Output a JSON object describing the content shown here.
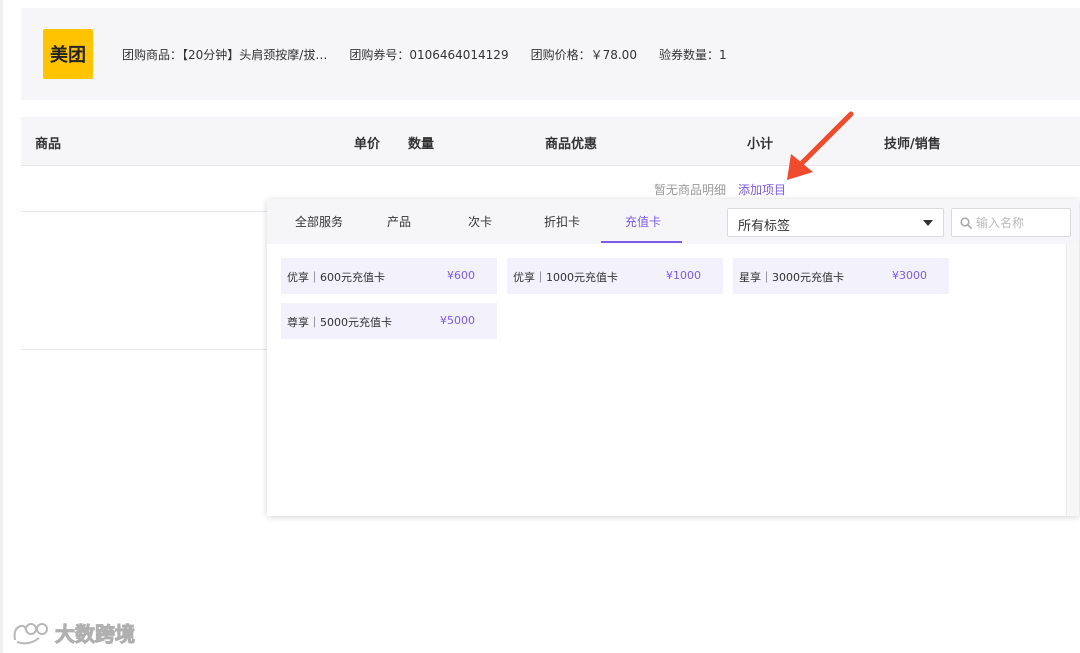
{
  "voucher": {
    "logo_text": "美团",
    "product": "团购商品：【20分钟】头肩颈按摩/拔…",
    "code": "团购券号：0106464014129",
    "price": "团购价格：￥78.00",
    "quantity": "验券数量：1"
  },
  "table": {
    "headers": [
      "商品",
      "单价",
      "数量",
      "商品优惠",
      "小计",
      "技师/销售"
    ],
    "empty_text": "暂无商品明细",
    "add_label": "添加项目"
  },
  "panel": {
    "tabs": [
      {
        "label": "全部服务",
        "active": false
      },
      {
        "label": "产品",
        "active": false
      },
      {
        "label": "次卡",
        "active": false
      },
      {
        "label": "折扣卡",
        "active": false
      },
      {
        "label": "充值卡",
        "active": true
      }
    ],
    "tag_select": {
      "value": "所有标签"
    },
    "search": {
      "placeholder": "输入名称",
      "value": ""
    },
    "items": [
      {
        "name": "优享｜600元充值卡",
        "price": "¥600"
      },
      {
        "name": "优享｜1000元充值卡",
        "price": "¥1000"
      },
      {
        "name": "星享｜3000元充值卡",
        "price": "¥3000"
      },
      {
        "name": "尊享｜5000元充值卡",
        "price": "¥5000"
      }
    ]
  },
  "watermark": {
    "text": "大数跨境"
  },
  "colors": {
    "accent": "#7d5ae8",
    "arrow": "#f04b2c",
    "logo_bg": "#ffc300",
    "card_bg": "#f3f1fb"
  }
}
